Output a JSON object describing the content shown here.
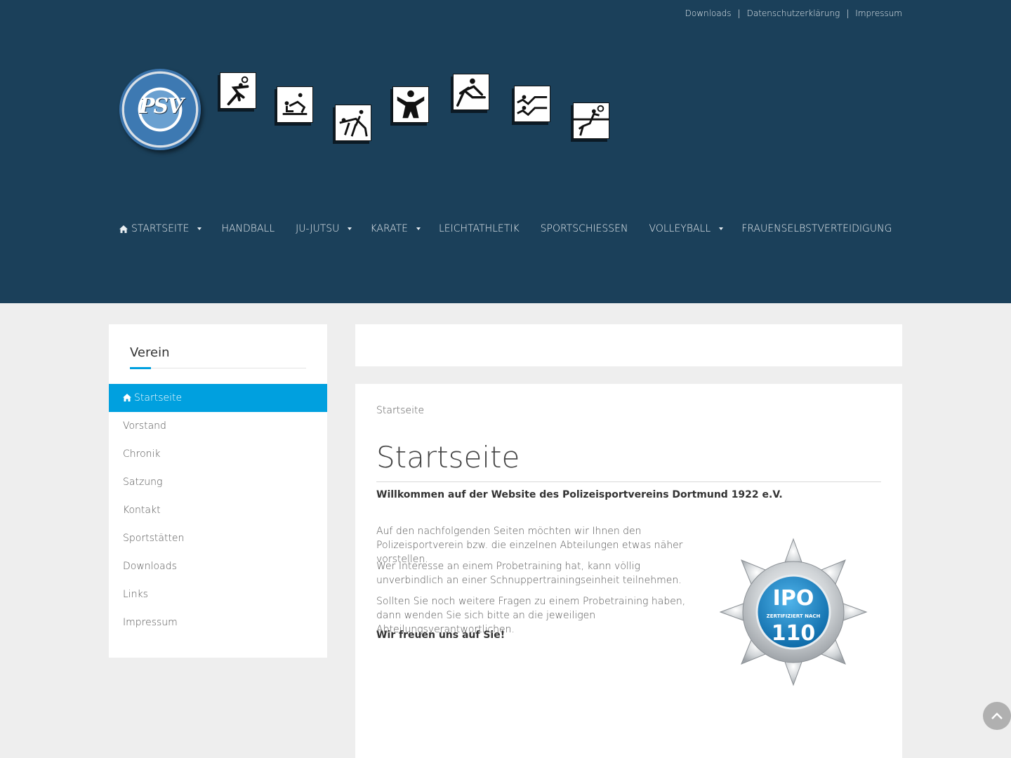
{
  "top_links": [
    "Downloads",
    "Datenschutzerklärung",
    "Impressum"
  ],
  "top_links_separator": "|",
  "logo": {
    "initials": "PSV"
  },
  "nav": [
    {
      "label": "STARTSEITE",
      "icon": "home-icon",
      "dropdown": true
    },
    {
      "label": "HANDBALL",
      "dropdown": false
    },
    {
      "label": "JU-JUTSU",
      "dropdown": true
    },
    {
      "label": "KARATE",
      "dropdown": true
    },
    {
      "label": "LEICHTATHLETIK",
      "dropdown": false
    },
    {
      "label": "SPORTSCHIESSEN",
      "dropdown": false
    },
    {
      "label": "VOLLEYBALL",
      "dropdown": true
    },
    {
      "label": "FRAUENSELBSTVERTEIDIGUNG",
      "dropdown": false
    }
  ],
  "sidebar": {
    "title": "Verein",
    "items": [
      {
        "label": "Startseite",
        "active": true,
        "icon": "home-icon"
      },
      {
        "label": "Vorstand"
      },
      {
        "label": "Chronik"
      },
      {
        "label": "Satzung"
      },
      {
        "label": "Kontakt"
      },
      {
        "label": "Sportstätten"
      },
      {
        "label": "Downloads"
      },
      {
        "label": "Links"
      },
      {
        "label": "Impressum"
      }
    ]
  },
  "content": {
    "breadcrumb": "Startseite",
    "heading": "Startseite",
    "welcome": "Willkommen auf der Website des Polizeisportvereins Dortmund 1922 e.V.",
    "paragraphs": [
      "Auf den nachfolgenden Seiten möchten wir Ihnen den Polizeisportverein bzw. die einzelnen Abteilungen etwas näher vorstellen.",
      "Wer Interesse an einem Probetraining hat, kann völlig unverbindlich an einer Schnuppertrainingseinheit teilnehmen.",
      "Sollten Sie noch weitere Fragen zu einem Probetraining haben, dann wenden Sie sich bitte an die jeweiligen Abteilungsverantwortlichen."
    ],
    "closing": "Wir freuen uns auf Sie!"
  },
  "badge": {
    "top": "IPO",
    "middle": "ZERTIFIZIERT NACH",
    "bottom": "110"
  },
  "colors": {
    "header": "#1b405a",
    "accent": "#00a0df",
    "background": "#eeeeee"
  }
}
